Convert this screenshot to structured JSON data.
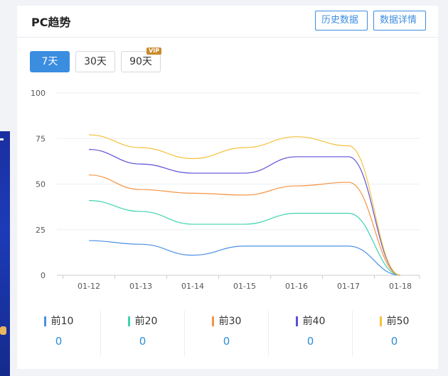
{
  "header": {
    "title": "PC趋势",
    "history_btn": "历史数据",
    "detail_btn": "数据详情"
  },
  "range_tabs": [
    {
      "label": "7天",
      "active": true
    },
    {
      "label": "30天",
      "active": false
    },
    {
      "label": "90天",
      "active": false,
      "badge": "VIP"
    }
  ],
  "colors": {
    "primary": "#3b8de0",
    "top10": "#4a90e2",
    "top20": "#3fd3b0",
    "top30": "#f59342",
    "top40": "#5b4fd8",
    "top50": "#f5c23c"
  },
  "chart_data": {
    "type": "line",
    "x": [
      "01-12",
      "01-13",
      "01-14",
      "01-15",
      "01-16",
      "01-17",
      "01-18"
    ],
    "ylim": [
      0,
      100
    ],
    "yticks": [
      0,
      25,
      50,
      75,
      100
    ],
    "grid": true,
    "legend_position": "bottom",
    "series": [
      {
        "name": "前10",
        "color": "#4a90e2",
        "values": [
          19,
          17,
          11,
          16,
          16,
          16,
          0
        ]
      },
      {
        "name": "前20",
        "color": "#3fd3b0",
        "values": [
          41,
          35,
          28,
          28,
          34,
          34,
          0
        ]
      },
      {
        "name": "前30",
        "color": "#f59342",
        "values": [
          55,
          47,
          45,
          44,
          49,
          51,
          0
        ]
      },
      {
        "name": "前40",
        "color": "#5b4fd8",
        "values": [
          69,
          61,
          56,
          56,
          65,
          65,
          0
        ]
      },
      {
        "name": "前50",
        "color": "#f5c23c",
        "values": [
          77,
          70,
          64,
          70,
          76,
          71,
          0
        ]
      }
    ]
  },
  "legend": [
    {
      "label": "前10",
      "value": "0"
    },
    {
      "label": "前20",
      "value": "0"
    },
    {
      "label": "前30",
      "value": "0"
    },
    {
      "label": "前40",
      "value": "0"
    },
    {
      "label": "前50",
      "value": "0"
    }
  ]
}
